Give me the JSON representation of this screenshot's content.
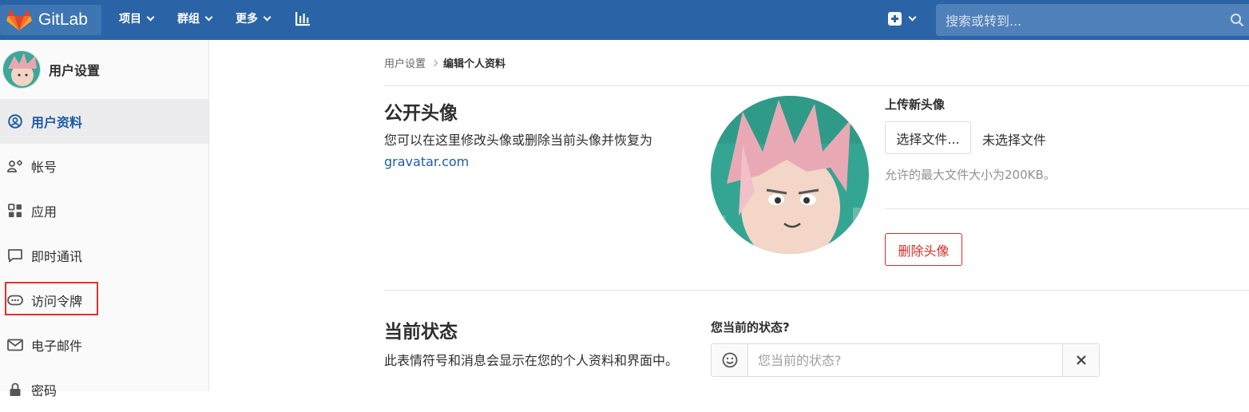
{
  "navbar": {
    "brand": "GitLab",
    "items": [
      {
        "label": "项目"
      },
      {
        "label": "群组"
      },
      {
        "label": "更多"
      }
    ],
    "search_placeholder": "搜索或转到..."
  },
  "sidebar": {
    "title": "用户设置",
    "items": [
      {
        "label": "用户资料",
        "icon": "profile-icon",
        "active": true
      },
      {
        "label": "帐号",
        "icon": "account-icon"
      },
      {
        "label": "应用",
        "icon": "applications-icon"
      },
      {
        "label": "即时通讯",
        "icon": "chat-icon"
      },
      {
        "label": "访问令牌",
        "icon": "token-icon",
        "highlighted": true
      },
      {
        "label": "电子邮件",
        "icon": "mail-icon"
      },
      {
        "label": "密码",
        "icon": "lock-icon"
      }
    ]
  },
  "breadcrumb": {
    "parent": "用户设置",
    "current": "编辑个人资料"
  },
  "avatar_section": {
    "title": "公开头像",
    "description": "您可以在这里修改头像或删除当前头像并恢复为",
    "link": "gravatar.com",
    "upload_title": "上传新头像",
    "choose_file": "选择文件...",
    "no_file": "未选择文件",
    "max_size_help": "允许的最大文件大小为200KB。",
    "remove_button": "删除头像"
  },
  "status_section": {
    "title": "当前状态",
    "description": "此表情符号和消息会显示在您的个人资料和界面中。",
    "label": "您当前的状态?",
    "placeholder": "您当前的状态?"
  },
  "colors": {
    "navbar": "#2b64a6",
    "accent": "#1f5ca2",
    "danger": "#d22f27",
    "highlight_box": "#e03131"
  }
}
